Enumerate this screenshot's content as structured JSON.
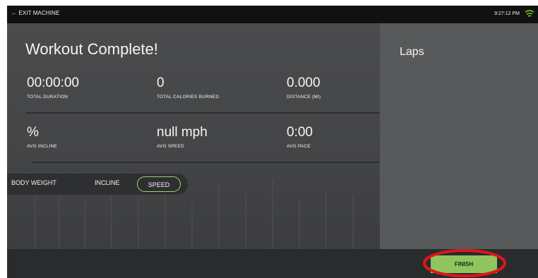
{
  "topbar": {
    "exit_label": "← EXIT MACHINE",
    "time": "9:27:12 PM",
    "wifi_icon": "wifi-icon",
    "wifi_color": "#7ed321"
  },
  "workout": {
    "title": "Workout Complete!",
    "stats_row1": [
      {
        "value": "00:00:00",
        "label": "TOTAL DURATION"
      },
      {
        "value": "0",
        "label": "TOTAL CALORIES BURNED"
      },
      {
        "value": "0.000",
        "label": "DISTANCE (MI)"
      }
    ],
    "stats_row2": [
      {
        "value": "%",
        "label": "AVG INCLINE"
      },
      {
        "value": "null mph",
        "label": "AVG SPEED"
      },
      {
        "value": "0:00",
        "label": "AVG PACE"
      }
    ]
  },
  "toggle": {
    "options": [
      "BODY WEIGHT",
      "INCLINE",
      "SPEED"
    ],
    "selected": "SPEED",
    "accent": "#9ed36a"
  },
  "laps": {
    "title": "Laps"
  },
  "footer": {
    "finish_label": "FINISH",
    "finish_color": "#8fc45e",
    "highlight_color": "#e0151b"
  }
}
